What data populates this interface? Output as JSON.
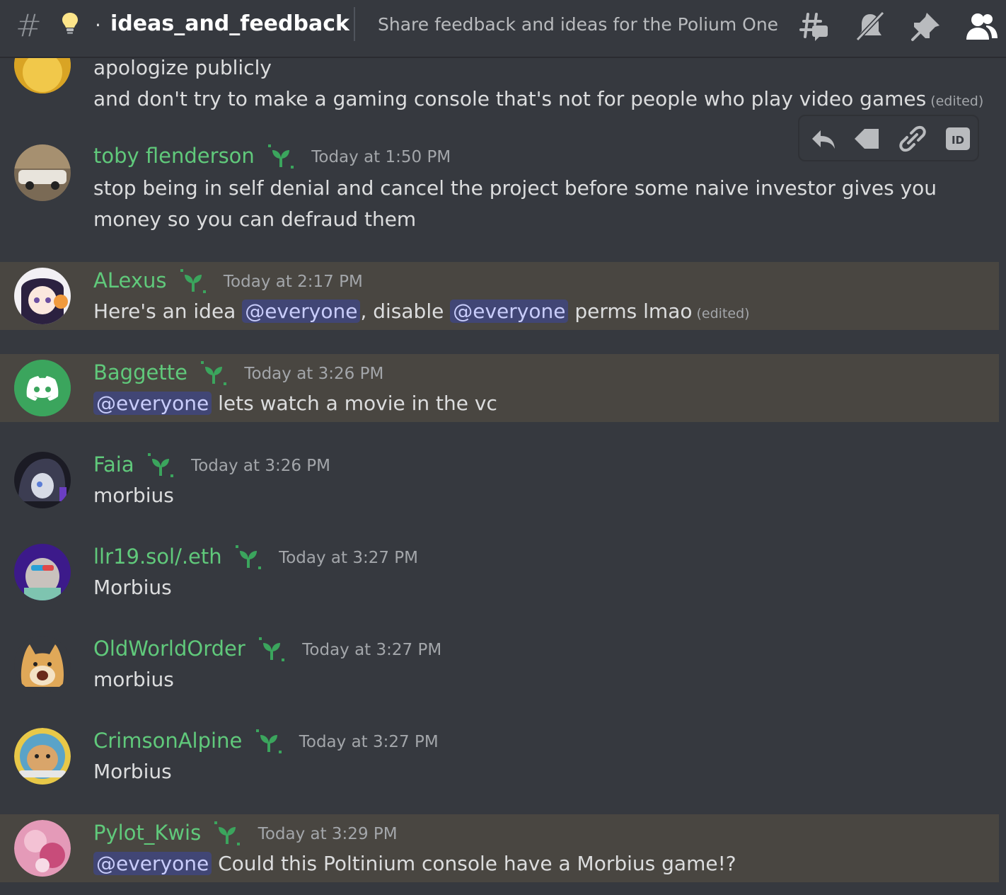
{
  "header": {
    "hash_symbol": "#",
    "dot": "·",
    "channel_name": "ideas_and_feedback",
    "topic": "Share feedback and ideas for the Polium One c..."
  },
  "toolbar": {
    "id_label": "ID"
  },
  "messages": [
    {
      "continuation": true,
      "lines": [
        "apologize publicly",
        "and don't try to make a gaming console that's not for people who play video games"
      ],
      "edited": "(edited)"
    },
    {
      "username": "toby flenderson",
      "timestamp": "Today at 1:50 PM",
      "lines": [
        "stop being in self denial and cancel the project before some naive investor gives you",
        "money so you can defraud them"
      ]
    },
    {
      "username": "ALexus",
      "timestamp": "Today at 2:17 PM",
      "highlighted": true,
      "text_a": "Here's an idea ",
      "mention_a": "@everyone",
      "text_b": ", disable ",
      "mention_b": "@everyone",
      "text_c": " perms lmao",
      "edited": "(edited)"
    },
    {
      "username": "Baggette",
      "timestamp": "Today at 3:26 PM",
      "highlighted": true,
      "mention": "@everyone",
      "text": " lets watch a movie in the vc"
    },
    {
      "username": "Faia",
      "timestamp": "Today at 3:26 PM",
      "text": "morbius"
    },
    {
      "username": "llr19.sol/.eth",
      "timestamp": "Today at 3:27 PM",
      "text": "Morbius"
    },
    {
      "username": "OldWorldOrder",
      "timestamp": "Today at 3:27 PM",
      "text": "morbius"
    },
    {
      "username": "CrimsonAlpine",
      "timestamp": "Today at 3:27 PM",
      "text": "Morbius"
    },
    {
      "username": "Pylot_Kwis",
      "timestamp": "Today at 3:29 PM",
      "highlighted": true,
      "mention": "@everyone",
      "text": " Could this Poltinium console have a Morbius game!?"
    }
  ],
  "icons": {
    "header": [
      "hash-icon",
      "lightbulb-icon",
      "threads-icon",
      "mute-bell-icon",
      "pin-icon",
      "member-list-icon"
    ],
    "toolbar": [
      "reply-icon",
      "tag-icon",
      "link-icon",
      "id-icon"
    ]
  },
  "colors": {
    "background": "#36393f",
    "highlight": "#494641",
    "username": "#60c97b",
    "mention_bg": "#414675",
    "mention_text": "#c9cdfb"
  }
}
